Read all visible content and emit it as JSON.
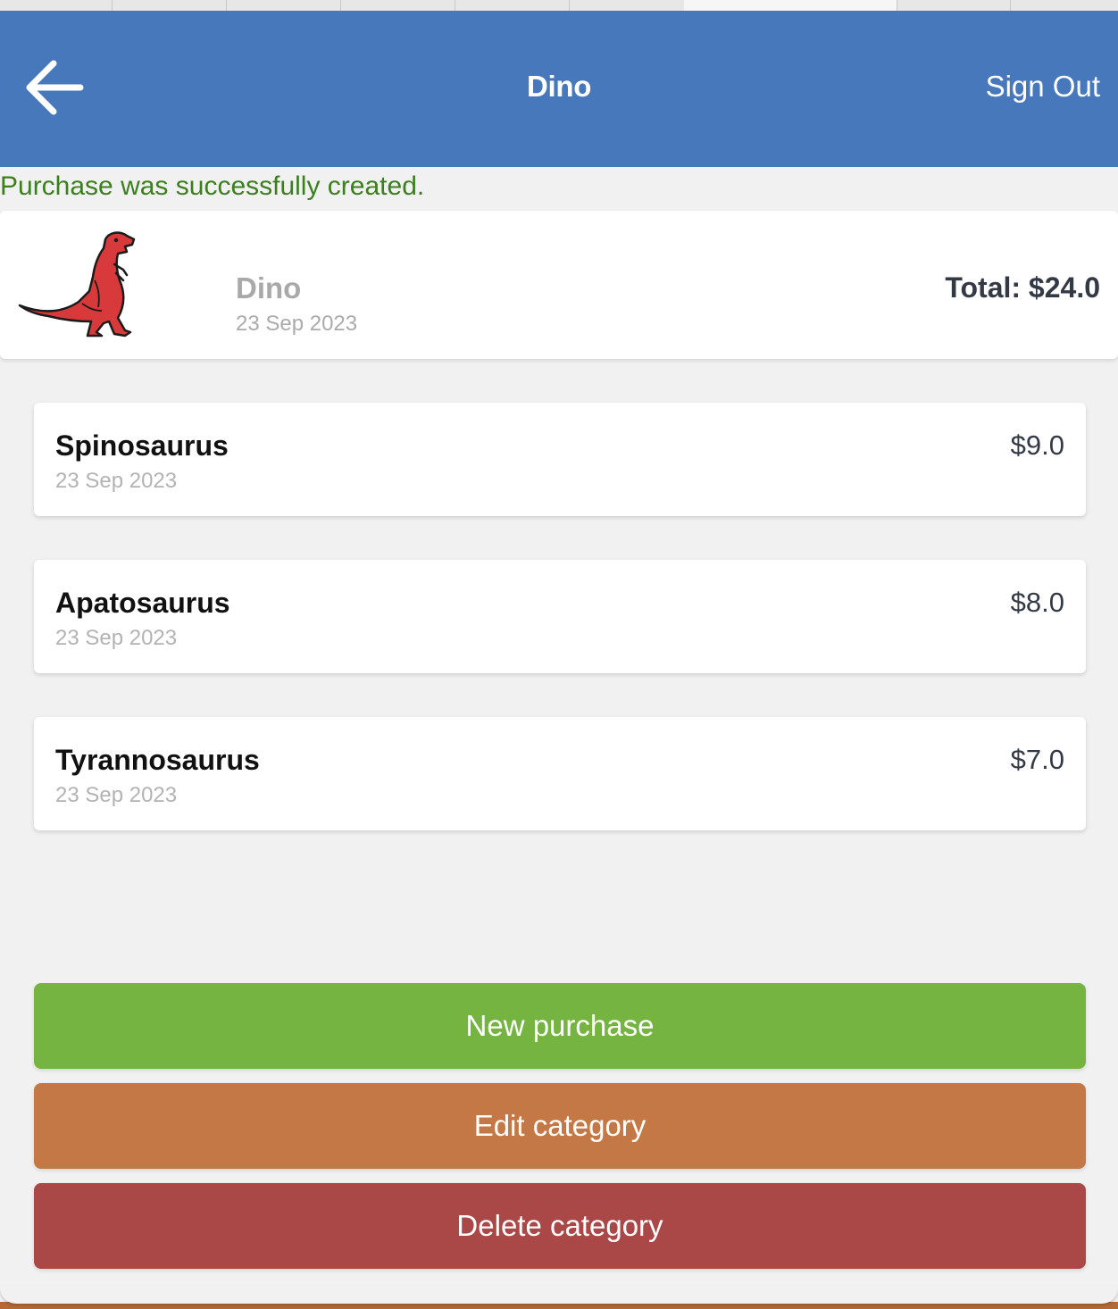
{
  "header": {
    "title": "Dino",
    "sign_out_label": "Sign Out",
    "background_color": "#4878bc"
  },
  "flash": {
    "message": "Purchase was successfully created.",
    "color": "#3b7f1f"
  },
  "category": {
    "icon": "red-tyrannosaurus-logo",
    "name": "Dino",
    "date": "23 Sep 2023",
    "total_label": "Total: $24.0"
  },
  "purchases": [
    {
      "name": "Spinosaurus",
      "date": "23 Sep 2023",
      "amount": "$9.0"
    },
    {
      "name": "Apatosaurus",
      "date": "23 Sep 2023",
      "amount": "$8.0"
    },
    {
      "name": "Tyrannosaurus",
      "date": "23 Sep 2023",
      "amount": "$7.0"
    }
  ],
  "actions": {
    "new_purchase": {
      "label": "New purchase",
      "color": "#76b442"
    },
    "edit_category": {
      "label": "Edit category",
      "color": "#c47845"
    },
    "delete_category": {
      "label": "Delete category",
      "color": "#aa4747"
    }
  }
}
